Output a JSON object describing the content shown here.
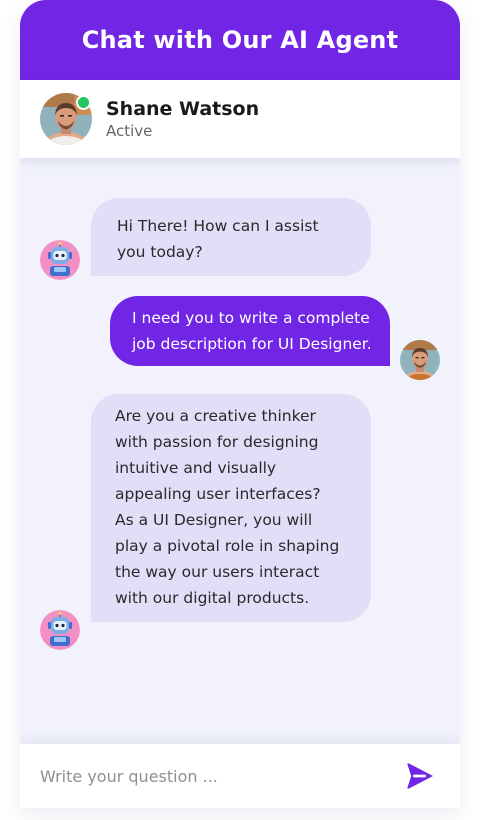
{
  "header": {
    "title": "Chat with Our AI Agent"
  },
  "user": {
    "name": "Shane Watson",
    "status": "Active"
  },
  "messages": [
    {
      "sender": "bot",
      "text": "Hi There! How can I assist you today?"
    },
    {
      "sender": "user",
      "text": "I need you to write a complete job description for UI Designer."
    },
    {
      "sender": "bot",
      "text": "Are you a creative thinker with passion for designing intuitive and visually appealing user interfaces? As a UI Designer, you will play a pivotal role in shaping the way our users interact with our digital products."
    }
  ],
  "input": {
    "placeholder": "Write your question ...",
    "value": ""
  },
  "icons": {
    "send": "send-icon",
    "user_avatar": "user-photo-avatar",
    "bot_avatar": "robot-avatar",
    "online": "online-status-dot"
  },
  "colors": {
    "accent": "#7126e6",
    "bot_bubble": "#e3ddf8",
    "chat_background": "#f1f2fc",
    "bot_avatar_background": "#f48fc3",
    "online": "#22c55e"
  }
}
